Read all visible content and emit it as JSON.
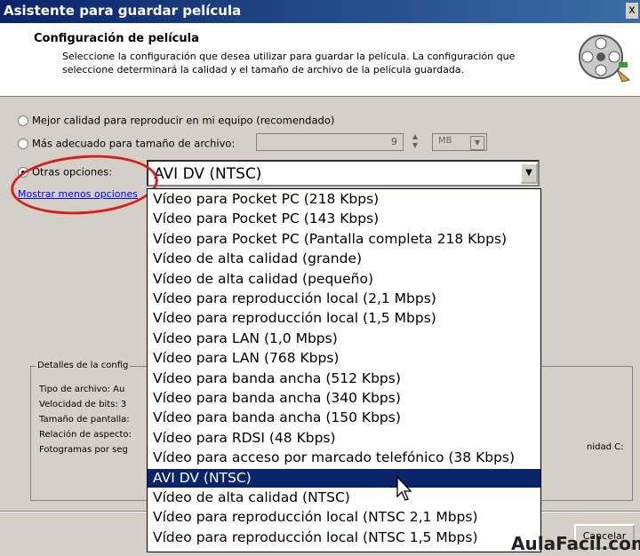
{
  "window": {
    "title": "Asistente para guardar película",
    "close_label": "x"
  },
  "header": {
    "title": "Configuración de película",
    "description": "Seleccione la configuración que desea utilizar para guardar la película. La configuración que seleccione determinará la calidad y el tamaño de archivo de la película guardada."
  },
  "options": {
    "best_quality": "Mejor calidad para reproducir en mi equipo (recomendado)",
    "best_size": "Más adecuado para tamaño de archivo:",
    "size_value": "9",
    "size_unit": "MB",
    "other": "Otras opciones:",
    "selected_value": "AVI DV (NTSC)",
    "less_options": "Mostrar menos opciones"
  },
  "dropdown_items": [
    "Vídeo para Pocket PC (218 Kbps)",
    "Vídeo para Pocket PC (143 Kbps)",
    "Vídeo para Pocket PC (Pantalla completa 218 Kbps)",
    "Vídeo de alta calidad (grande)",
    "Vídeo de alta calidad (pequeño)",
    "Vídeo para reproducción local (2,1 Mbps)",
    "Vídeo para reproducción local (1,5 Mbps)",
    "Vídeo para LAN (1,0 Mbps)",
    "Vídeo para LAN (768 Kbps)",
    "Vídeo para banda ancha (512 Kbps)",
    "Vídeo para banda ancha (340 Kbps)",
    "Vídeo para banda ancha (150 Kbps)",
    "Vídeo para RDSI (48 Kbps)",
    "Vídeo para acceso por marcado telefónico (38 Kbps)",
    "AVI DV (NTSC)",
    "Vídeo de alta calidad (NTSC)",
    "Vídeo para reproducción local (NTSC 2,1 Mbps)",
    "Vídeo para reproducción local (NTSC 1,5 Mbps)"
  ],
  "selected_index": 14,
  "details": {
    "legend": "Detalles de la config",
    "file_type": "Tipo de archivo: Au",
    "bitrate": "Velocidad de bits: 3",
    "screen_size": "Tamaño de pantalla:",
    "aspect_ratio": "Relación de aspecto:",
    "fps": "Fotogramas por seg",
    "drive_label": "nidad C:"
  },
  "buttons": {
    "cancel": "Cancelar"
  },
  "watermark": "AulaFacil.com",
  "colors": {
    "title_bar": "#0a246a",
    "selection": "#0a246a",
    "highlight_oval": "#d42020"
  }
}
